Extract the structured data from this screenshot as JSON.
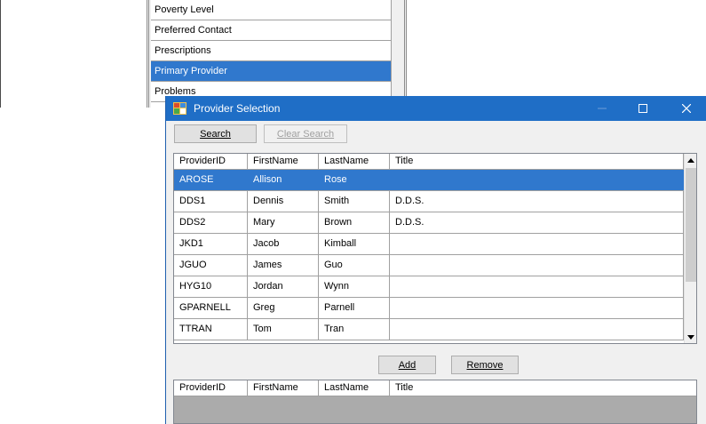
{
  "background_list": {
    "items": [
      "Poverty Level",
      "Preferred Contact",
      "Prescriptions",
      "Primary Provider",
      "Problems"
    ],
    "selected_index": 3
  },
  "dialog": {
    "title": "Provider Selection",
    "search_label": "Search",
    "clear_search_label": "Clear Search",
    "add_label": "Add",
    "remove_label": "Remove"
  },
  "grid": {
    "columns": [
      "ProviderID",
      "FirstName",
      "LastName",
      "Title"
    ],
    "rows": [
      {
        "id": "AROSE",
        "first": "Allison",
        "last": "Rose",
        "title": ""
      },
      {
        "id": "DDS1",
        "first": "Dennis",
        "last": "Smith",
        "title": "D.D.S."
      },
      {
        "id": "DDS2",
        "first": "Mary",
        "last": "Brown",
        "title": "D.D.S."
      },
      {
        "id": "JKD1",
        "first": "Jacob",
        "last": "Kimball",
        "title": ""
      },
      {
        "id": "JGUO",
        "first": "James",
        "last": "Guo",
        "title": ""
      },
      {
        "id": "HYG10",
        "first": "Jordan",
        "last": "Wynn",
        "title": ""
      },
      {
        "id": "GPARNELL",
        "first": "Greg",
        "last": "Parnell",
        "title": ""
      },
      {
        "id": "TTRAN",
        "first": "Tom",
        "last": "Tran",
        "title": ""
      }
    ],
    "selected_index": 0
  },
  "selected_grid": {
    "columns": [
      "ProviderID",
      "FirstName",
      "LastName",
      "Title"
    ]
  },
  "colors": {
    "titlebar": "#1f6ec6",
    "selection": "#3078cd"
  }
}
